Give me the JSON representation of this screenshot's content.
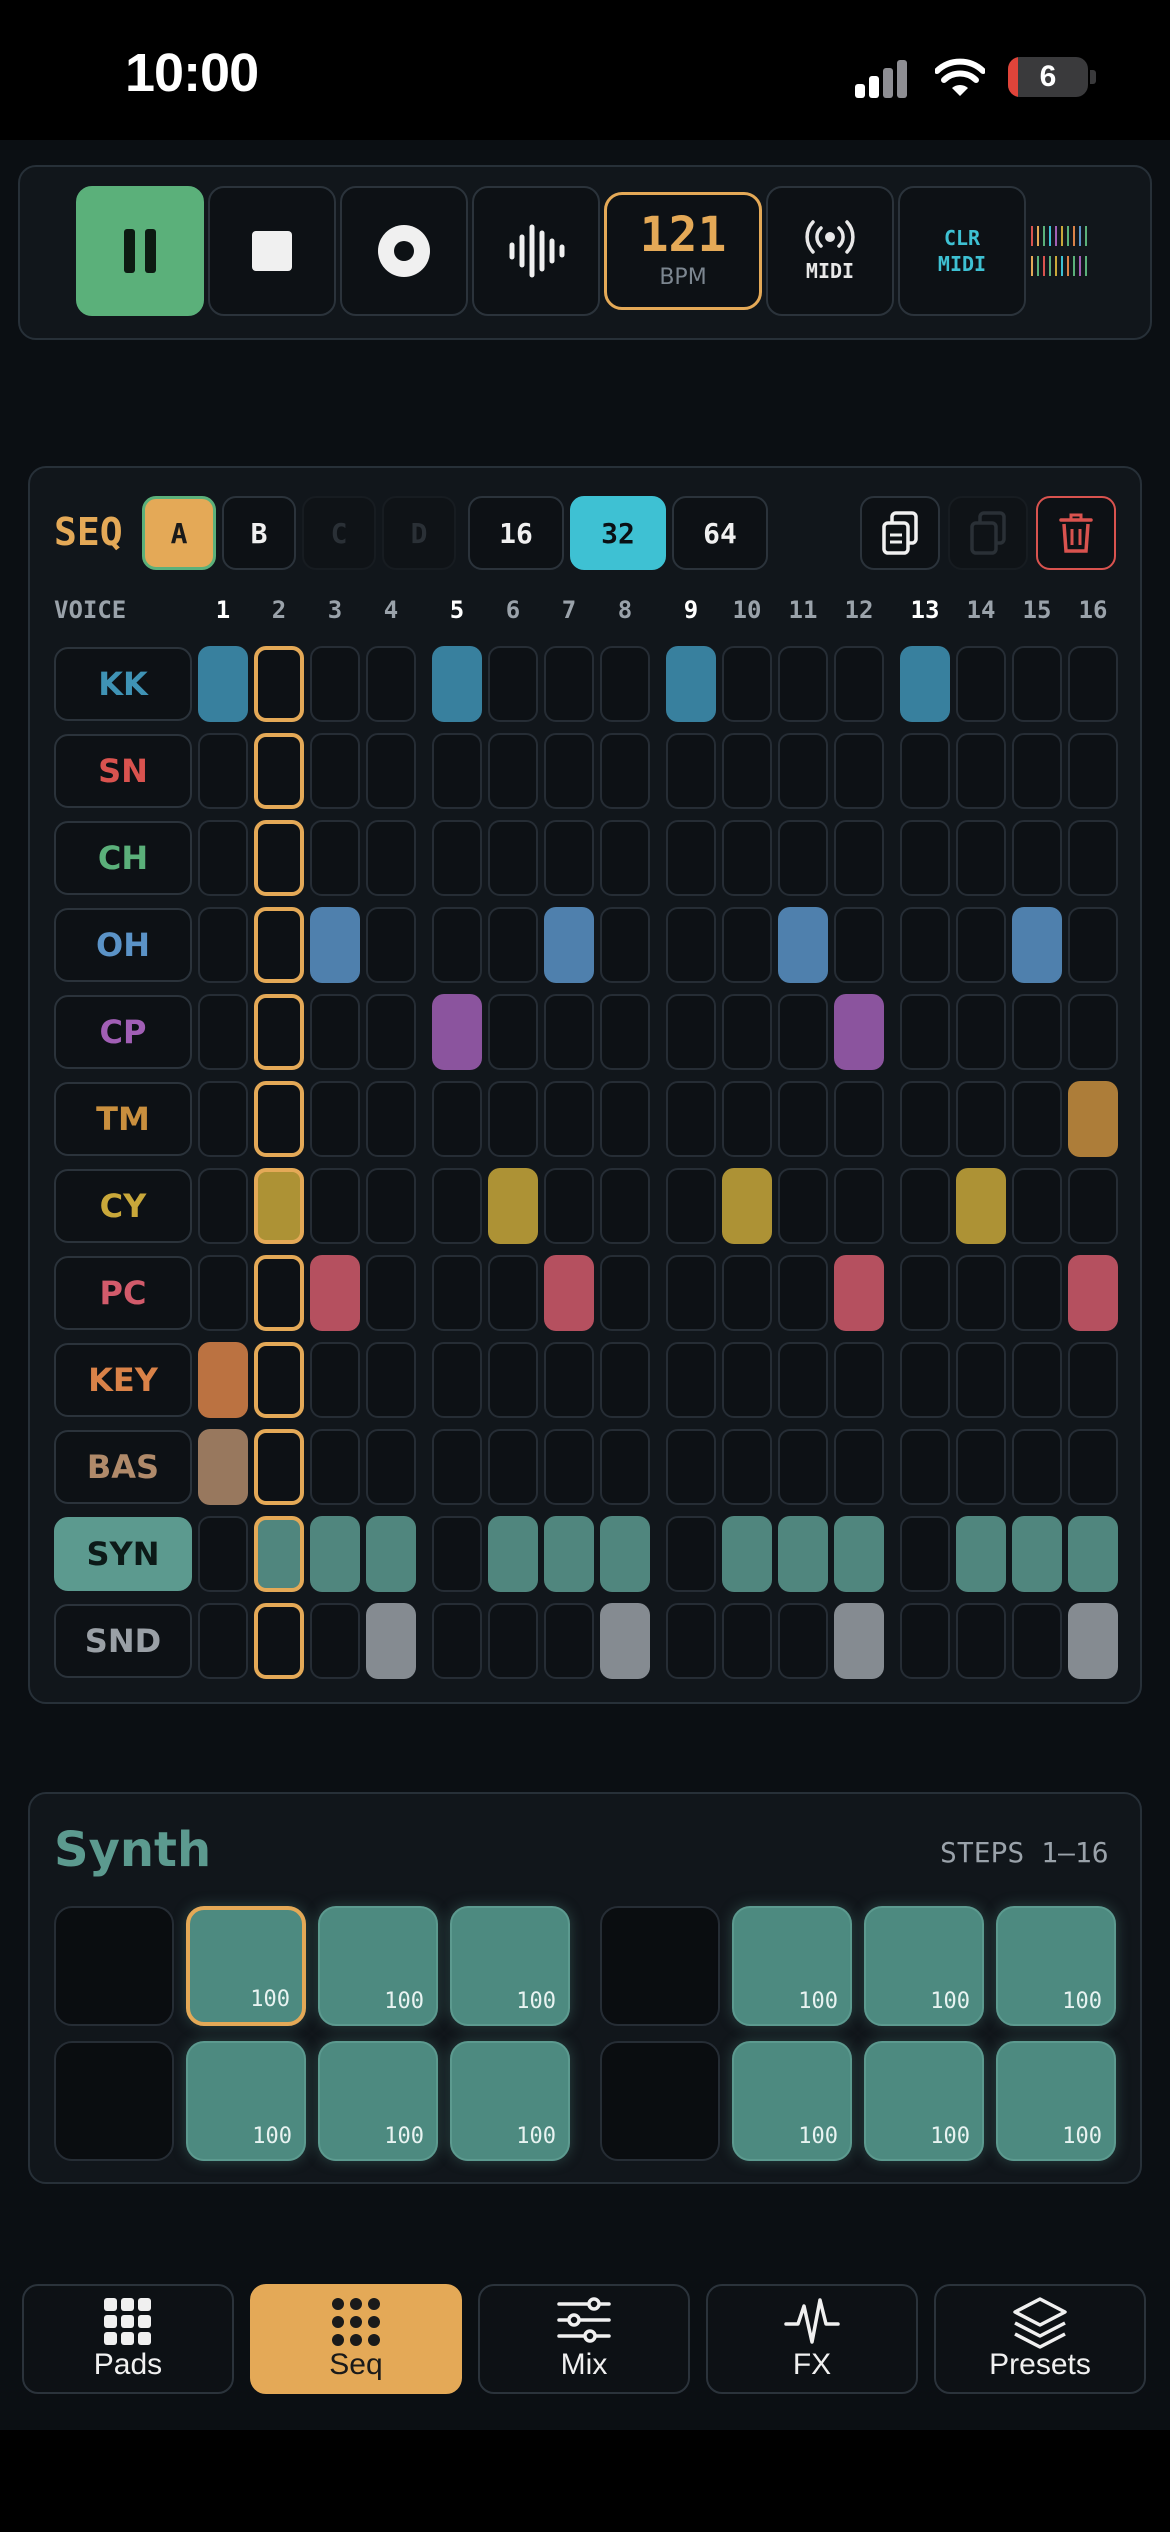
{
  "status": {
    "time": "10:00",
    "battery": "6"
  },
  "transport": {
    "bpm_value": "121",
    "bpm_label": "BPM",
    "midi_label": "MIDI",
    "clr_line1": "CLR",
    "clr_line2": "MIDI"
  },
  "seq": {
    "label": "SEQ",
    "patterns": [
      "A",
      "B",
      "C",
      "D"
    ],
    "active_pattern": "A",
    "lengths": [
      "16",
      "32",
      "64"
    ],
    "selected_length": "32",
    "voice_header": "VOICE",
    "step_numbers": [
      "1",
      "2",
      "3",
      "4",
      "5",
      "6",
      "7",
      "8",
      "9",
      "10",
      "11",
      "12",
      "13",
      "14",
      "15",
      "16"
    ],
    "current_step": 2,
    "voices": [
      {
        "name": "KK",
        "color": "#3f93b5",
        "steps": [
          1,
          5,
          9,
          13
        ]
      },
      {
        "name": "SN",
        "color": "#d9534f",
        "steps": []
      },
      {
        "name": "CH",
        "color": "#5bb07a",
        "steps": []
      },
      {
        "name": "OH",
        "color": "#5b93c7",
        "steps": [
          3,
          7,
          11,
          15
        ]
      },
      {
        "name": "CP",
        "color": "#a15fb5",
        "steps": [
          5,
          12
        ]
      },
      {
        "name": "TM",
        "color": "#c98f3e",
        "steps": [
          16
        ]
      },
      {
        "name": "CY",
        "color": "#c9a83a",
        "steps": [
          2,
          6,
          10,
          14
        ]
      },
      {
        "name": "PC",
        "color": "#d25b6b",
        "steps": [
          3,
          7,
          12,
          16
        ]
      },
      {
        "name": "KEY",
        "color": "#d98248",
        "steps": [
          1
        ]
      },
      {
        "name": "BAS",
        "color": "#b08a6a",
        "steps": [
          1
        ]
      },
      {
        "name": "SYN",
        "color": "#5c9a8f",
        "steps": [
          2,
          3,
          4,
          6,
          7,
          8,
          10,
          11,
          12,
          14,
          15,
          16
        ],
        "selected": true
      },
      {
        "name": "SND",
        "color": "#9aa0a6",
        "steps": [
          4,
          8,
          12,
          16
        ]
      }
    ]
  },
  "synth": {
    "title": "Synth",
    "steps_label": "STEPS 1–16",
    "rows": [
      [
        null,
        "100",
        "100",
        "100",
        null,
        "100",
        "100",
        "100"
      ],
      [
        null,
        "100",
        "100",
        "100",
        null,
        "100",
        "100",
        "100"
      ]
    ]
  },
  "tabs": [
    {
      "label": "Pads",
      "icon": "grid-icon"
    },
    {
      "label": "Seq",
      "icon": "dots-grid-icon",
      "active": true
    },
    {
      "label": "Mix",
      "icon": "sliders-icon"
    },
    {
      "label": "FX",
      "icon": "pulse-icon"
    },
    {
      "label": "Presets",
      "icon": "layers-icon"
    }
  ],
  "colors": {
    "accent": "#e4a957",
    "teal": "#3ec1d3",
    "play": "#5bb07a",
    "synth": "#5c9a8f",
    "delete": "#d9534f"
  }
}
